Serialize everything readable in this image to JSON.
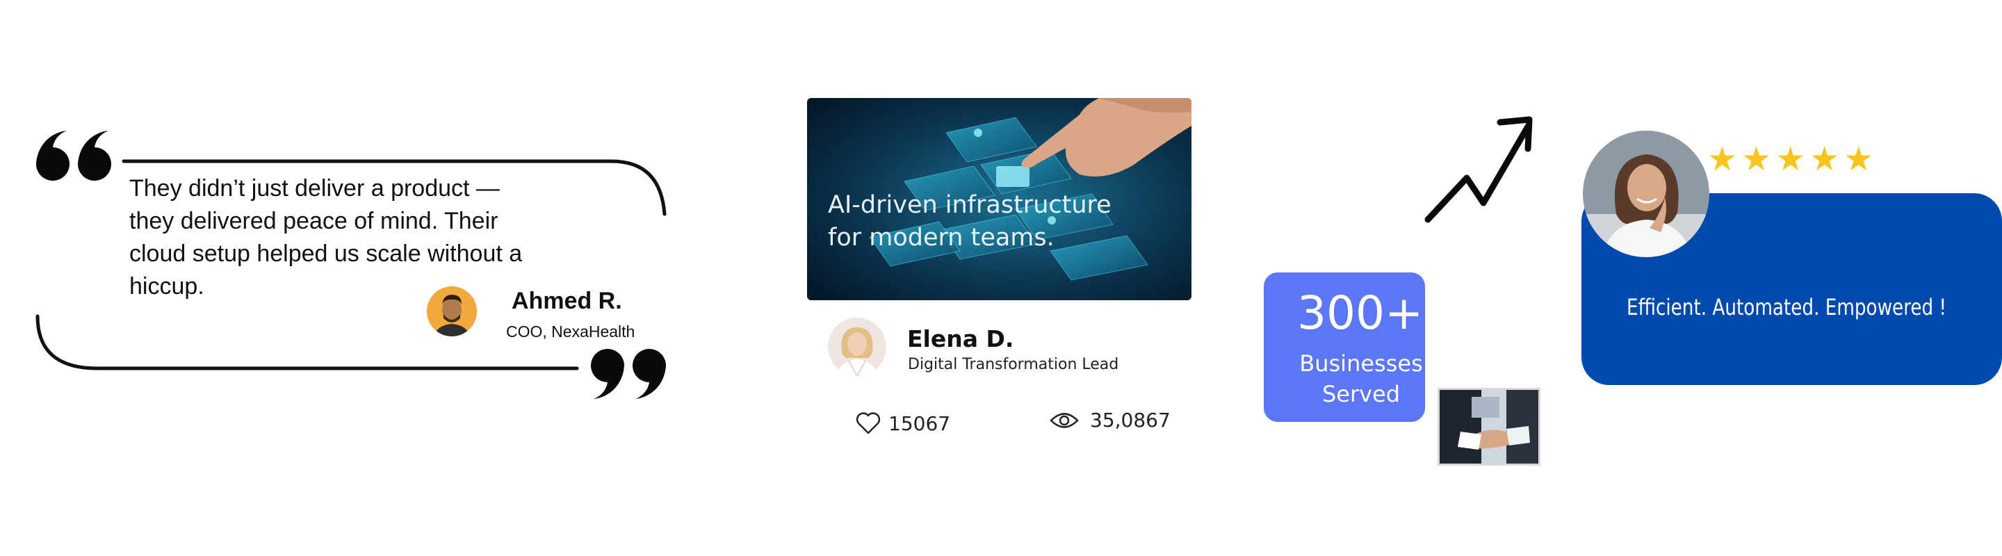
{
  "testimonial_1": {
    "quote_lines": [
      "They didn’t just deliver a product —",
      "they delivered peace of mind. Their",
      "cloud setup helped us scale without a",
      "hiccup."
    ],
    "author_name": "Ahmed R.",
    "author_role": "COO, NexaHealth",
    "open_quote_icon": "open-quote-icon",
    "close_quote_icon": "close-quote-icon"
  },
  "article_card": {
    "headline_lines": [
      "AI-driven infrastructure",
      "for modern teams."
    ],
    "author_name": "Elena D.",
    "author_role": "Digital Transformation Lead",
    "likes": "15067",
    "views": "35,0867",
    "like_icon": "heart-icon",
    "view_icon": "eye-icon"
  },
  "stats": {
    "number": "300+",
    "label_lines": [
      "Businesses",
      "Served"
    ],
    "arrow_icon": "trend-up-arrow-icon"
  },
  "review": {
    "rating": 5,
    "rating_max": 5,
    "slogan": "Efficient. Automated. Empowered !"
  },
  "colors": {
    "stat_card": "#5b76f6",
    "review_card": "#004aad",
    "star": "#f7c51e",
    "text": "#111111"
  }
}
